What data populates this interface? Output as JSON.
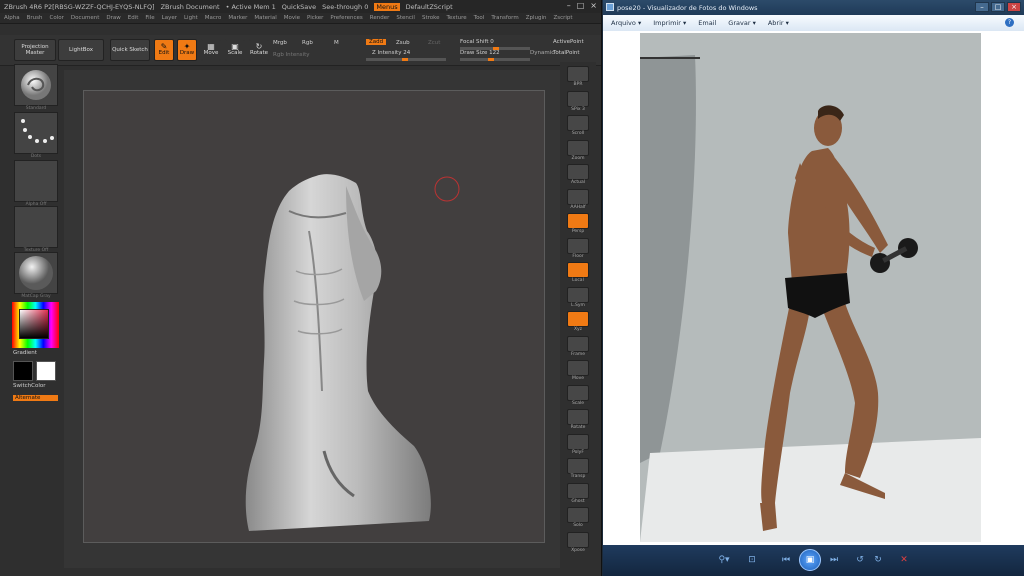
{
  "zbrush": {
    "title_items": [
      "ZBrush 4R6 P2[RBSG-WZZF-QCHJ-EYQS-NLFQ]",
      "ZBrush Document",
      "• Active Mem 1",
      "QuickSave",
      "See-through 0",
      "Menus",
      "DefaultZScript"
    ],
    "menus": [
      "Alpha",
      "Brush",
      "Color",
      "Document",
      "Draw",
      "Edit",
      "File",
      "Layer",
      "Light",
      "Macro",
      "Marker",
      "Material",
      "Movie",
      "Picker",
      "Preferences",
      "Render",
      "Stencil",
      "Stroke",
      "Texture",
      "Tool",
      "Transform",
      "Zplugin",
      "Zscript"
    ],
    "shelf": {
      "projection_master": "Projection Master",
      "lightbox": "LightBox",
      "quick_sketch": "Quick Sketch",
      "edit": "Edit",
      "draw": "Draw",
      "move": "Move",
      "scale": "Scale",
      "rotate": "Rotate",
      "mrgb": "Mrgb",
      "rgb": "Rgb",
      "m": "M",
      "rgb_intensity": "Rgb Intensity",
      "zadd": "Zadd",
      "zsub": "Zsub",
      "zcut": "Zcut",
      "z_intensity": "Z Intensity 24",
      "focal_shift": "Focal Shift 0",
      "draw_size": "Draw Size 122",
      "dynamic": "Dynamic",
      "active_points": "ActivePoint",
      "total_points": "TotalPoint"
    },
    "left": {
      "brush_label": "Standard",
      "stroke_label": "Dots",
      "alpha_label": "Alpha Off",
      "texture_label": "Texture Off",
      "material_label": "MatCap Gray",
      "gradient": "Gradient",
      "switch_color": "SwitchColor",
      "alternate": "Alternate"
    },
    "right": [
      "BPR",
      "SPix 3",
      "Scroll",
      "Zoom",
      "Actual",
      "AAHalf",
      "Persp",
      "Floor",
      "Local",
      "L.Sym",
      "Xyz",
      "Frame",
      "Move",
      "Scale",
      "Rotate",
      "PolyF",
      "Transp",
      "Ghost",
      "Solo",
      "Xpose"
    ]
  },
  "viewer": {
    "title": "pose20 - Visualizador de Fotos do Windows",
    "menu": [
      "Arquivo",
      "Imprimir",
      "Email",
      "Gravar",
      "Abrir"
    ],
    "help": "?"
  },
  "colors": {
    "accent": "#f07a14",
    "zbrush_bg": "#2f2f2f",
    "canvas": "#423f3f",
    "viewer_bar": "#1f3b5e"
  }
}
